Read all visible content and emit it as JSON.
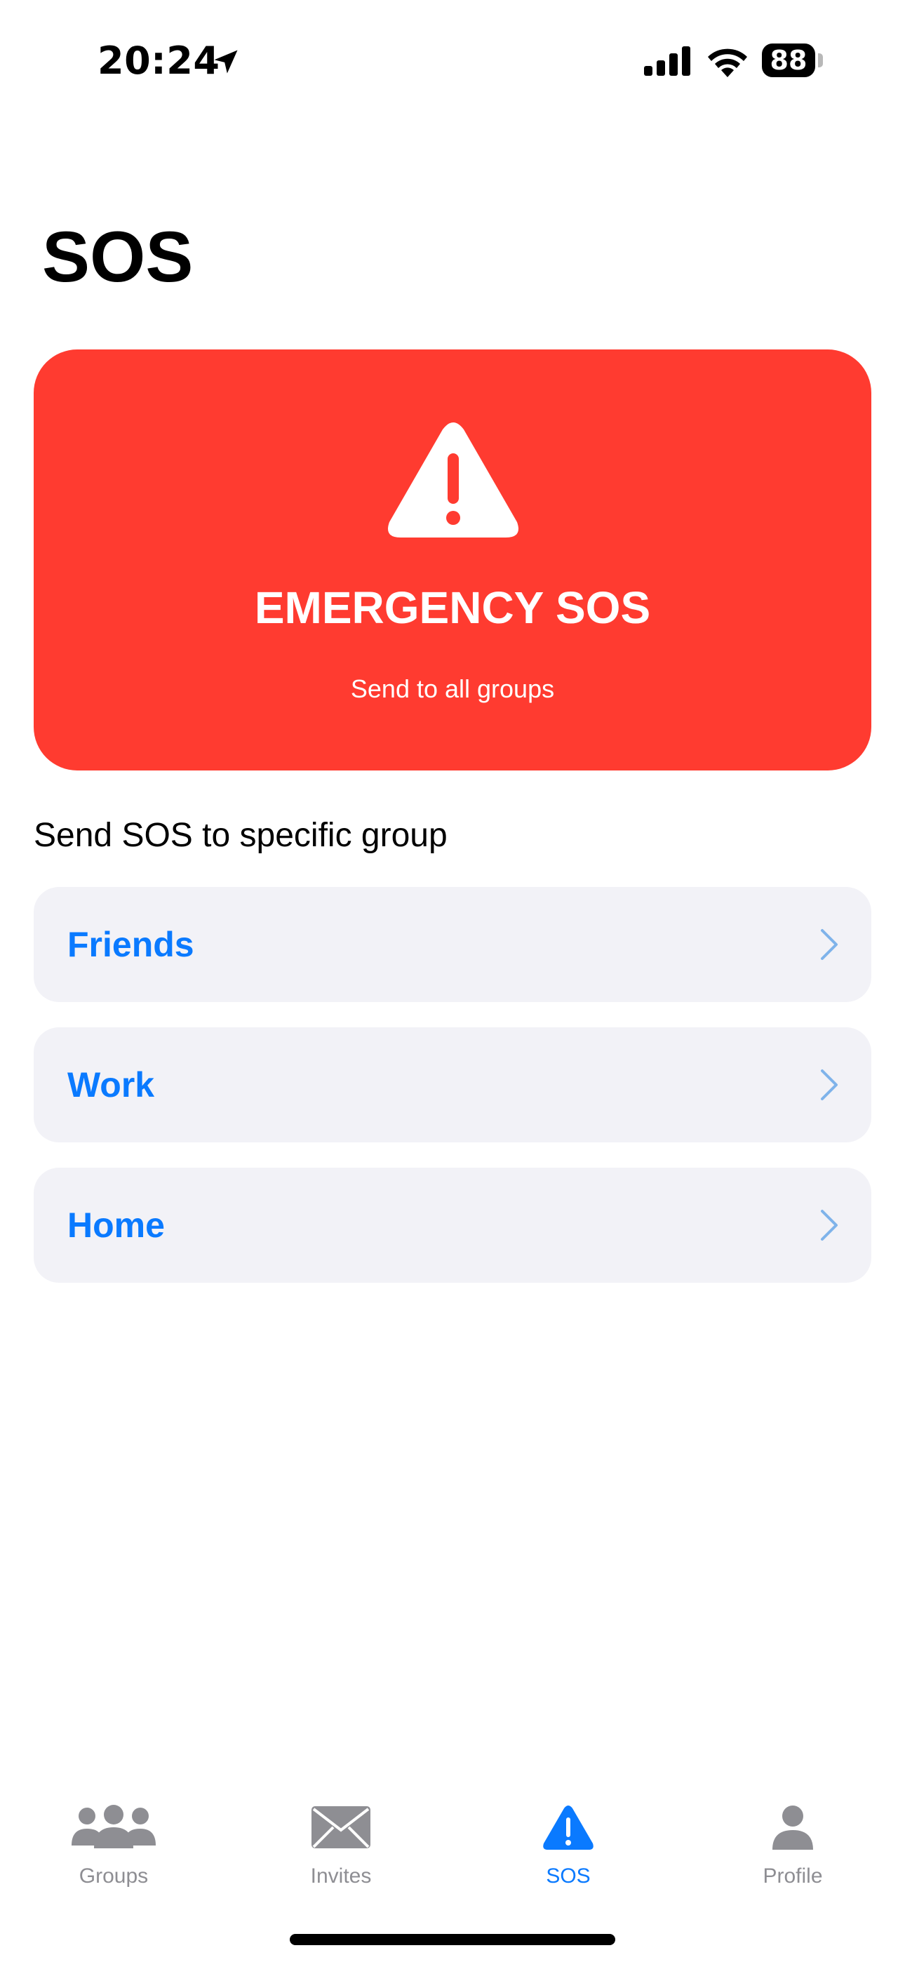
{
  "status_bar": {
    "time": "20:24",
    "battery": "88",
    "icons": [
      "location-arrow-icon",
      "cellular-signal-icon",
      "wifi-icon",
      "battery-icon"
    ]
  },
  "page": {
    "title": "SOS"
  },
  "emergency": {
    "title": "EMERGENCY SOS",
    "subtitle": "Send to all groups",
    "icon": "warning-triangle-icon",
    "color": "#ff3b30"
  },
  "groups_section": {
    "heading": "Send SOS to specific group",
    "items": [
      {
        "label": "Friends"
      },
      {
        "label": "Work"
      },
      {
        "label": "Home"
      }
    ]
  },
  "tabs": [
    {
      "label": "Groups",
      "icon": "people-icon",
      "active": false
    },
    {
      "label": "Invites",
      "icon": "envelope-icon",
      "active": false
    },
    {
      "label": "SOS",
      "icon": "warning-triangle-icon",
      "active": true
    },
    {
      "label": "Profile",
      "icon": "person-icon",
      "active": false
    }
  ],
  "colors": {
    "accent": "#0a7aff",
    "danger": "#ff3b30",
    "row_background": "#f2f2f7",
    "inactive": "#8e8e93"
  }
}
